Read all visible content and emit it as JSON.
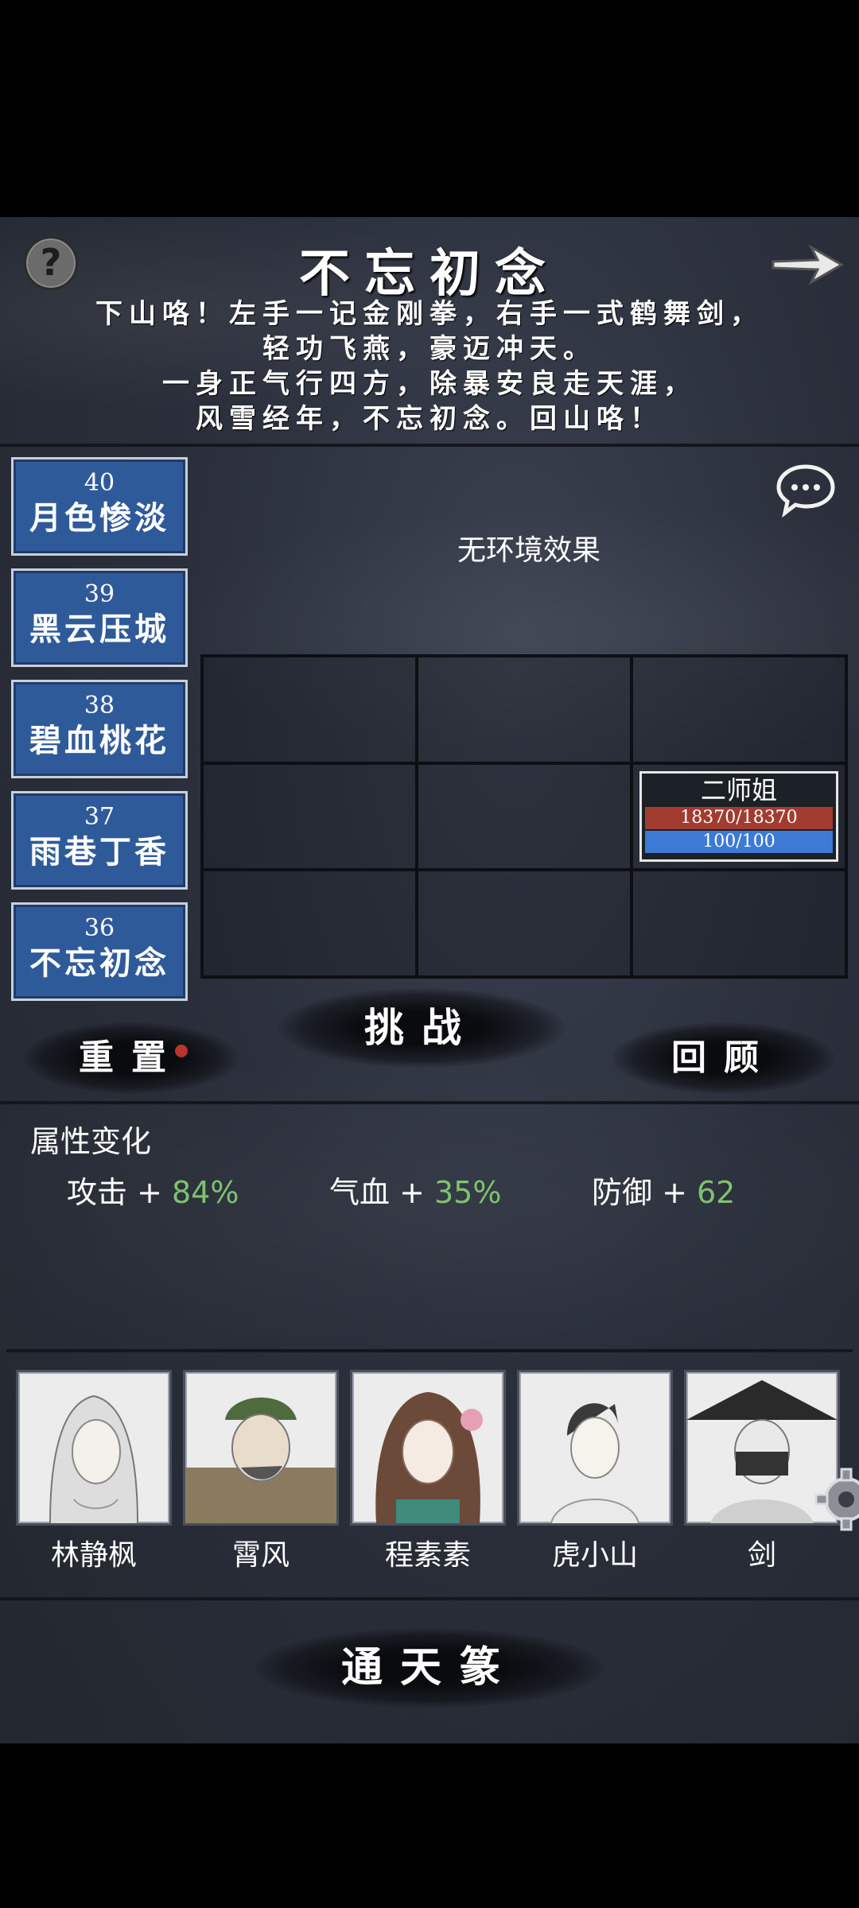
{
  "header": {
    "title": "不忘初念",
    "help_icon": "question-mark-icon",
    "next_icon": "arrow-right-icon",
    "poem": [
      "下山咯！左手一记金刚拳，右手一式鹤舞剑，",
      "轻功飞燕，豪迈冲天。",
      "一身正气行四方，除暴安良走天涯，",
      "风雪经年，不忘初念。回山咯！"
    ]
  },
  "levels": [
    {
      "num": "40",
      "name": "月色惨淡"
    },
    {
      "num": "39",
      "name": "黑云压城"
    },
    {
      "num": "38",
      "name": "碧血桃花"
    },
    {
      "num": "37",
      "name": "雨巷丁香"
    },
    {
      "num": "36",
      "name": "不忘初念"
    }
  ],
  "battle": {
    "chat_icon": "speech-bubble-icon",
    "environment": "无环境效果",
    "unit": {
      "name": "二师姐",
      "hp": "18370/18370",
      "mp": "100/100",
      "hp_fraction": 1.0,
      "mp_fraction": 1.0
    }
  },
  "actions": {
    "reset": "重置",
    "challenge": "挑战",
    "review": "回顾"
  },
  "attributes": {
    "title": "属性变化",
    "items": [
      {
        "label": "攻击 + ",
        "value": "84%"
      },
      {
        "label": "气血 + ",
        "value": "35%"
      },
      {
        "label": "防御 + ",
        "value": "62"
      }
    ]
  },
  "characters": [
    {
      "name": "林静枫"
    },
    {
      "name": "霄风"
    },
    {
      "name": "程素素"
    },
    {
      "name": "虎小山"
    },
    {
      "name": "剑"
    }
  ],
  "footer": {
    "button": "通天篆",
    "settings_icon": "gear-icon"
  },
  "colors": {
    "level_blue": "#2f5a9a",
    "hp_red": "#a23c30",
    "mp_blue": "#3d7ad6",
    "positive_green": "#7ec36e",
    "reset_dot": "#b8352c"
  }
}
